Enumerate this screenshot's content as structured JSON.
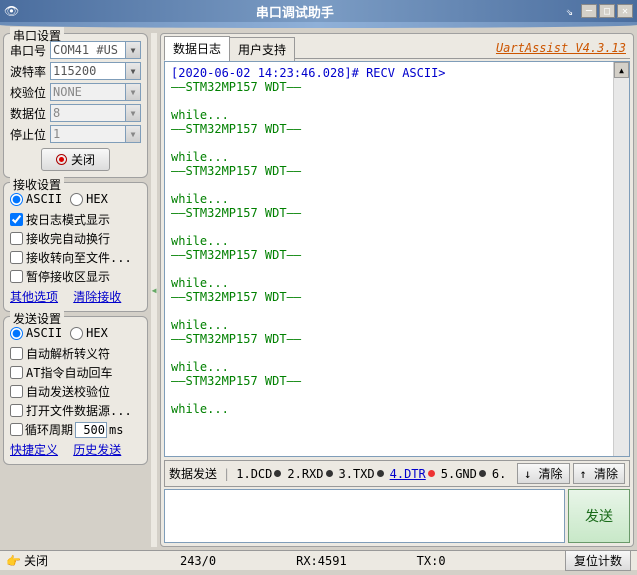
{
  "window": {
    "title": "串口调试助手"
  },
  "version": "UartAssist V4.3.13",
  "port_settings": {
    "title": "串口设置",
    "fields": {
      "port": {
        "label": "串口号",
        "value": "COM41 #US"
      },
      "baud": {
        "label": "波特率",
        "value": "115200"
      },
      "parity": {
        "label": "校验位",
        "value": "NONE"
      },
      "databits": {
        "label": "数据位",
        "value": "8"
      },
      "stopbits": {
        "label": "停止位",
        "value": "1"
      }
    },
    "close_btn": "关闭"
  },
  "recv_settings": {
    "title": "接收设置",
    "ascii": "ASCII",
    "hex": "HEX",
    "opts": {
      "log_mode": "按日志模式显示",
      "auto_wrap": "接收完自动换行",
      "to_file": "接收转向至文件...",
      "pause": "暂停接收区显示"
    },
    "link_more": "其他选项",
    "link_clear": "清除接收"
  },
  "send_settings": {
    "title": "发送设置",
    "ascii": "ASCII",
    "hex": "HEX",
    "opts": {
      "auto_escape": "自动解析转义符",
      "at_cr": "AT指令自动回车",
      "auto_check": "自动发送校验位",
      "open_file": "打开文件数据源...",
      "cycle_label": "循环周期",
      "cycle_val": "500",
      "cycle_unit": "ms"
    },
    "link_quick": "快捷定义",
    "link_history": "历史发送"
  },
  "tabs": {
    "log": "数据日志",
    "support": "用户支持"
  },
  "log": {
    "header": "[2020-06-02 14:23:46.028]# RECV ASCII>",
    "wdt": "——STM32MP157 WDT——",
    "while": "while..."
  },
  "send_bar": {
    "title": "数据发送",
    "ind1": "1.DCD",
    "ind2": "2.RXD",
    "ind3": "3.TXD",
    "ind4": "4.DTR",
    "ind5": "5.GND",
    "ind6": "6.",
    "clear_down": "清除",
    "clear_up": "清除",
    "send": "发送"
  },
  "status": {
    "ready": "关闭",
    "counts": "243/0",
    "rx": "RX:4591",
    "tx": "TX:0",
    "reset": "复位计数"
  }
}
